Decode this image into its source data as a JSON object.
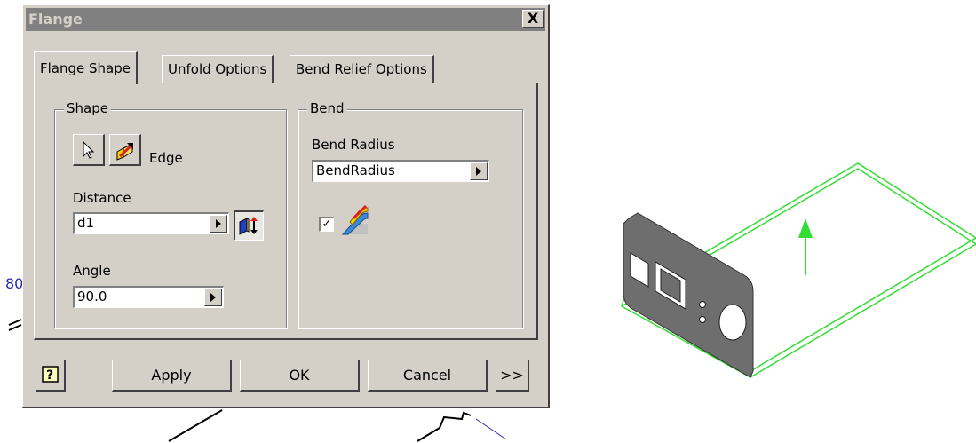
{
  "background": {
    "partial_label": "80"
  },
  "dialog": {
    "title": "Flange",
    "close_label": "X",
    "tabs": [
      {
        "label": "Flange Shape",
        "active": true
      },
      {
        "label": "Unfold Options",
        "active": false
      },
      {
        "label": "Bend Relief Options",
        "active": false
      }
    ],
    "shape": {
      "group_title": "Shape",
      "edge_label": "Edge",
      "distance_label": "Distance",
      "distance_value": "d1",
      "angle_label": "Angle",
      "angle_value": "90.0"
    },
    "bend": {
      "group_title": "Bend",
      "radius_label": "Bend Radius",
      "radius_value": "BendRadius",
      "checkbox_checked": true,
      "checkbox_mark": "✓"
    },
    "buttons": {
      "help": "?",
      "apply": "Apply",
      "ok": "OK",
      "cancel": "Cancel",
      "more": ">>"
    }
  },
  "colors": {
    "dialog_bg": "#d4d0c8",
    "titlebar": "#808080",
    "preview_green": "#33dd33",
    "part_gray": "#6e6e6e"
  },
  "icons": [
    "select-arrow-icon",
    "edge-select-icon",
    "flip-direction-icon",
    "bend-extents-icon",
    "help-icon"
  ]
}
